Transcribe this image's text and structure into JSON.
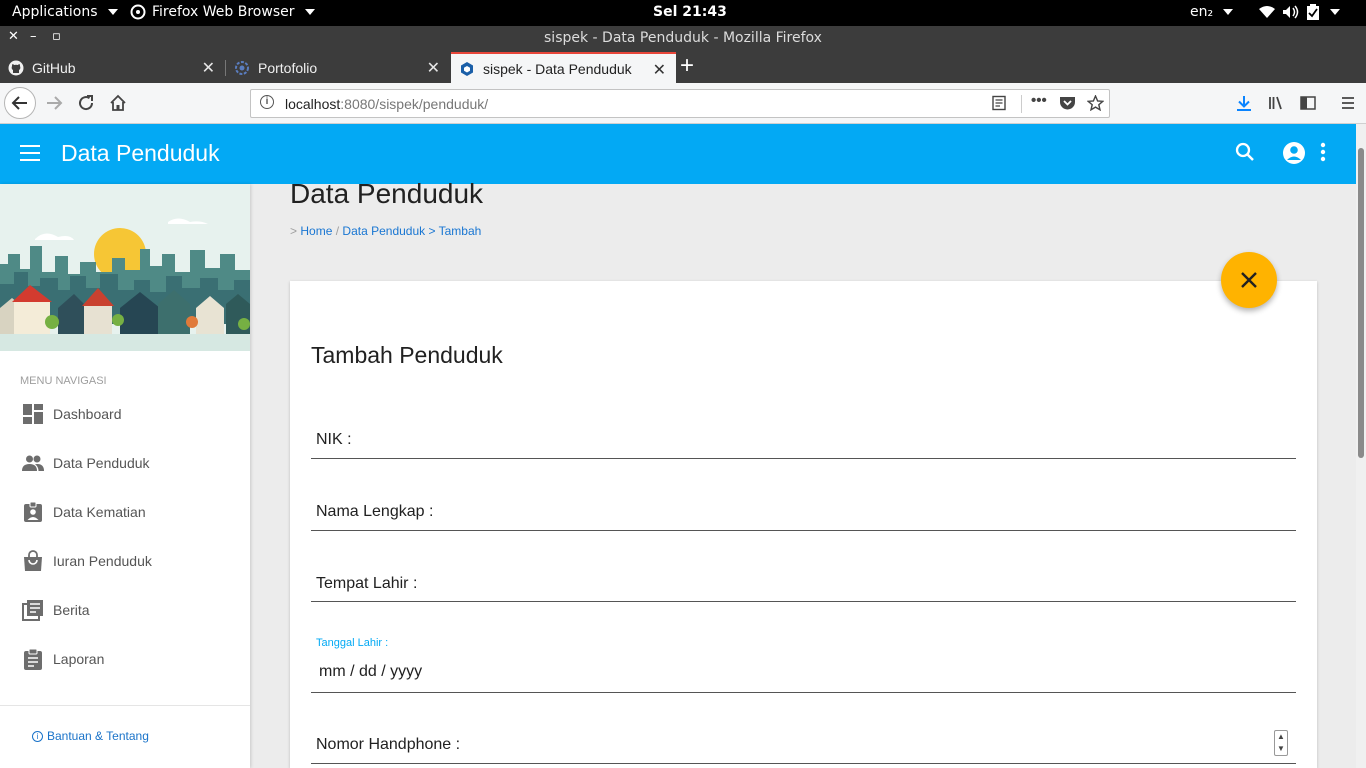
{
  "system_bar": {
    "applications": "Applications",
    "active_app": "Firefox Web Browser",
    "clock": "Sel 21:43",
    "input_method": "en₂"
  },
  "window": {
    "title": "sispek - Data Penduduk - Mozilla Firefox"
  },
  "tabs": [
    {
      "label": "GitHub",
      "icon": "github-icon"
    },
    {
      "label": "Portofolio",
      "icon": "gear-icon"
    },
    {
      "label": "sispek - Data Penduduk",
      "icon": "shield-icon",
      "active": true
    }
  ],
  "url": {
    "host": "localhost",
    "rest": ":8080/sispek/penduduk/"
  },
  "appbar": {
    "title": "Data Penduduk",
    "color": "#03a9f4"
  },
  "sidebar": {
    "menu_heading": "MENU NAVIGASI",
    "items": [
      {
        "label": "Dashboard",
        "icon": "dashboard-icon"
      },
      {
        "label": "Data Penduduk",
        "icon": "people-icon"
      },
      {
        "label": "Data Kematian",
        "icon": "badge-icon"
      },
      {
        "label": "Iuran Penduduk",
        "icon": "bag-icon"
      },
      {
        "label": "Berita",
        "icon": "news-icon"
      },
      {
        "label": "Laporan",
        "icon": "clipboard-icon"
      }
    ],
    "help_link": "Bantuan & Tentang"
  },
  "main": {
    "heading": "Data Penduduk",
    "breadcrumb": {
      "sep1": ">",
      "home": "Home",
      "sep2": "/",
      "section": "Data Penduduk",
      "sep3": ">",
      "current": "Tambah"
    },
    "fab_color": "#ffb300"
  },
  "form": {
    "title": "Tambah Penduduk",
    "fields": {
      "nik": "NIK :",
      "nama": "Nama Lengkap :",
      "tempat": "Tempat Lahir :",
      "tanggal_label": "Tanggal Lahir :",
      "tanggal_placeholder": "mm / dd / yyyy",
      "hp": "Nomor Handphone :"
    }
  }
}
